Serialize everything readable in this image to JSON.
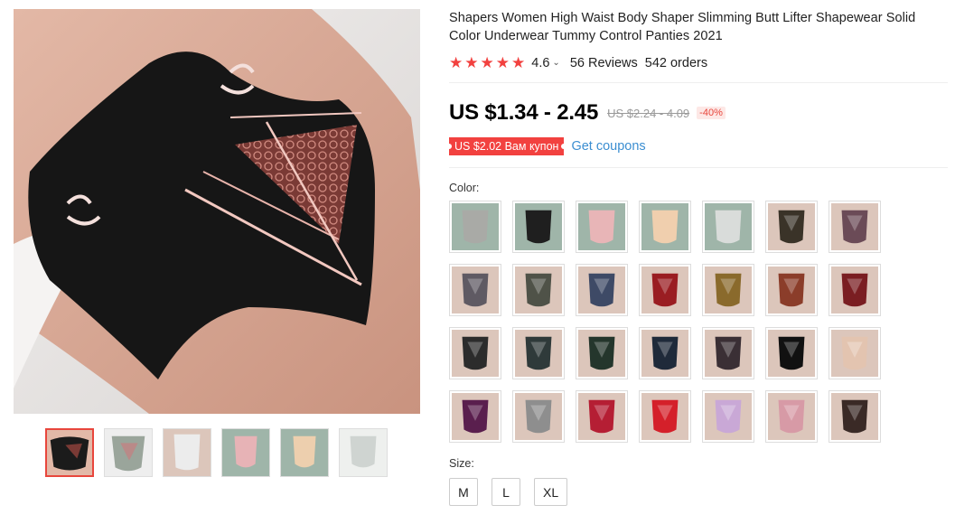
{
  "product": {
    "title": "Shapers Women High Waist Body Shaper Slimming Butt Lifter Shapewear Solid Color Underwear Tummy Control Panties 2021",
    "rating": "4.6",
    "reviews": "56 Reviews",
    "orders": "542 orders",
    "price": "US $1.34 - 2.45",
    "old_price": "US $2.24 - 4.09",
    "discount": "-40%",
    "coupon_badge": "US $2.02 Вам купон",
    "coupon_link": "Get coupons",
    "color_label": "Color:",
    "size_label": "Size:",
    "sizes": [
      "M",
      "L",
      "XL"
    ]
  },
  "stars": [
    "★",
    "★",
    "★",
    "★",
    "★"
  ],
  "icons": {
    "star": "star-icon",
    "chevron": "chevron-down-icon"
  },
  "colors": {
    "accent": "#f2413f",
    "link": "#3b8ed1",
    "swatches": [
      "#a9aaa6",
      "#1f1f1f",
      "#e8b5b7",
      "#f0cfae",
      "#d9dcda",
      "#3a3328",
      "#6b4b57",
      "#5f5a63",
      "#4f5248",
      "#3e4a66",
      "#9a1d22",
      "#8a6a2c",
      "#8b3d2a",
      "#7a1e22",
      "#2c2c2c",
      "#2f3a3a",
      "#24362c",
      "#1f2a3a",
      "#3a2f35",
      "#111111",
      "#e3c4b0",
      "#5a1f4e",
      "#8e8e8e",
      "#b51e34",
      "#d4202a",
      "#c9a8d6",
      "#d79aa6",
      "#3a2a26"
    ],
    "thumbs": [
      "#1b1b1b",
      "#9aa59b",
      "#e6e6e6",
      "#e7b3b6",
      "#edcfae",
      "#cfd4d1"
    ]
  }
}
